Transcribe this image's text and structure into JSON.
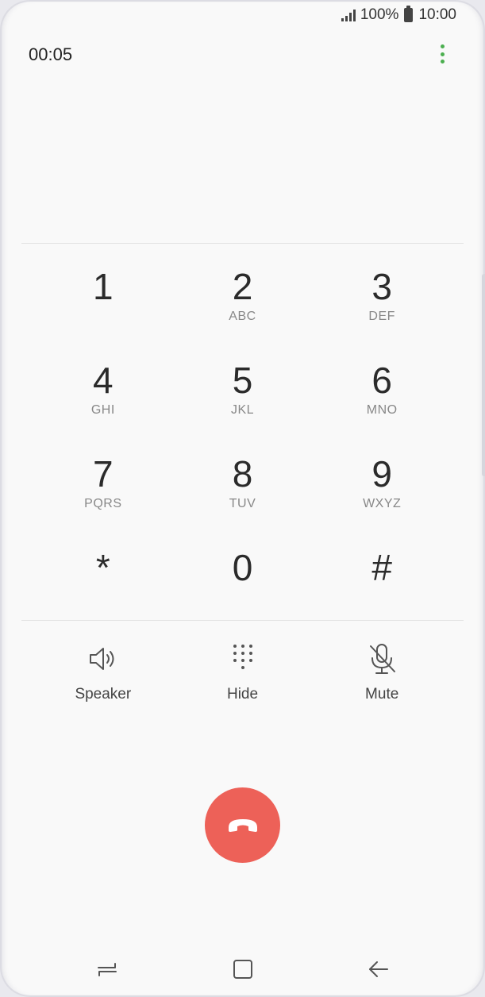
{
  "status_bar": {
    "battery": "100%",
    "time": "10:00"
  },
  "call": {
    "duration": "00:05"
  },
  "keypad": {
    "rows": [
      [
        {
          "digit": "1",
          "letters": ""
        },
        {
          "digit": "2",
          "letters": "ABC"
        },
        {
          "digit": "3",
          "letters": "DEF"
        }
      ],
      [
        {
          "digit": "4",
          "letters": "GHI"
        },
        {
          "digit": "5",
          "letters": "JKL"
        },
        {
          "digit": "6",
          "letters": "MNO"
        }
      ],
      [
        {
          "digit": "7",
          "letters": "PQRS"
        },
        {
          "digit": "8",
          "letters": "TUV"
        },
        {
          "digit": "9",
          "letters": "WXYZ"
        }
      ],
      [
        {
          "digit": "*",
          "letters": ""
        },
        {
          "digit": "0",
          "letters": ""
        },
        {
          "digit": "#",
          "letters": ""
        }
      ]
    ]
  },
  "controls": {
    "speaker": "Speaker",
    "hide": "Hide",
    "mute": "Mute"
  },
  "icons": {
    "more": "more-options-icon",
    "speaker": "speaker-icon",
    "hide": "keypad-icon",
    "mute": "mute-mic-icon",
    "end_call": "end-call-icon",
    "recent": "recent-apps-icon",
    "home": "home-icon",
    "back": "back-icon"
  },
  "colors": {
    "accent": "#4caf50",
    "end_call": "#ed6158"
  }
}
